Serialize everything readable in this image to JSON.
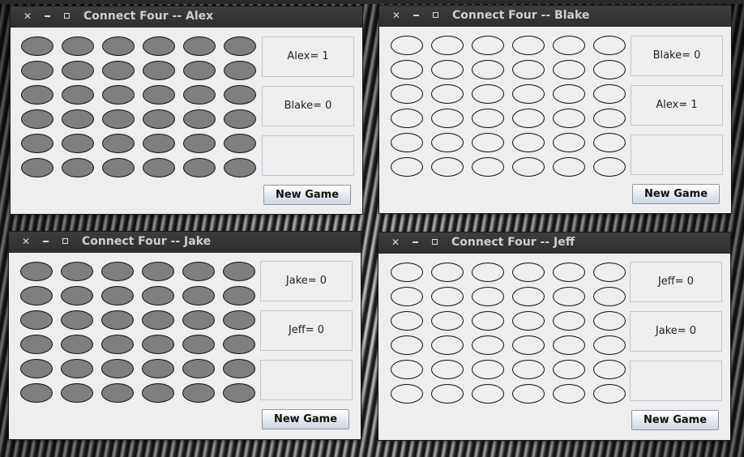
{
  "windows": [
    {
      "id": "alex",
      "title": "Connect Four -- Alex",
      "board": {
        "rows": 6,
        "cols": 6,
        "state": "filled"
      },
      "scores": [
        "Alex= 1",
        "Blake= 0",
        ""
      ],
      "new_game_label": "New Game"
    },
    {
      "id": "blake",
      "title": "Connect Four -- Blake",
      "board": {
        "rows": 6,
        "cols": 6,
        "state": "empty"
      },
      "scores": [
        "Blake= 0",
        "Alex= 1",
        ""
      ],
      "new_game_label": "New Game"
    },
    {
      "id": "jake",
      "title": "Connect Four -- Jake",
      "board": {
        "rows": 6,
        "cols": 6,
        "state": "filled"
      },
      "scores": [
        "Jake= 0",
        "Jeff= 0",
        ""
      ],
      "new_game_label": "New Game"
    },
    {
      "id": "jeff",
      "title": "Connect Four -- Jeff",
      "board": {
        "rows": 6,
        "cols": 6,
        "state": "empty"
      },
      "scores": [
        "Jeff= 0",
        "Jake= 0",
        ""
      ],
      "new_game_label": "New Game"
    }
  ],
  "titlebar_icons": [
    "close-icon",
    "minimize-icon",
    "maximize-icon"
  ],
  "colors": {
    "filled_disc": "#7f7f7f",
    "empty_disc": "#eeeeee",
    "titlebar": "#2e2e2e",
    "panel_border": "#b8c8d8"
  }
}
